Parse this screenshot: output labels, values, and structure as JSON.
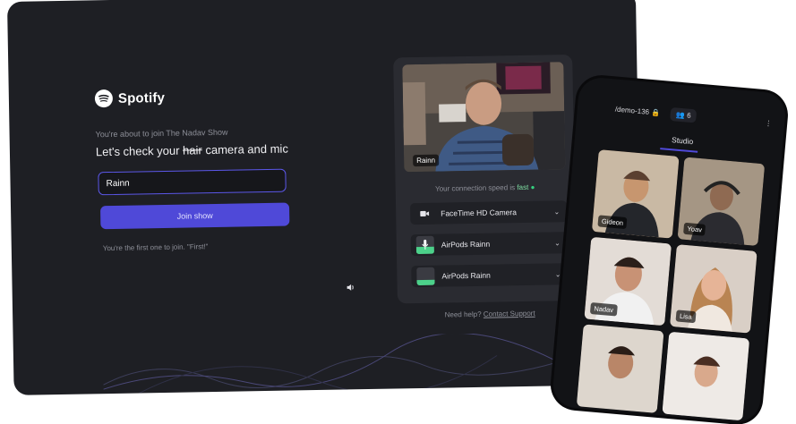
{
  "brand": {
    "name": "Spotify"
  },
  "join": {
    "about": "You're about to join The Nadav Show",
    "headline_prefix": "Let's check your",
    "headline_strike": "hair",
    "headline_suffix": "camera and mic",
    "name_value": "Rainn",
    "join_button": "Join show",
    "first_note": "You're the first one to join. \"First!\""
  },
  "preview": {
    "video_label": "Rainn",
    "speed_prefix": "Your connection speed is",
    "speed_value": "fast",
    "devices": [
      {
        "label": "FaceTime HD Camera",
        "icon": "video-camera-icon"
      },
      {
        "label": "AirPods Rainn",
        "icon": "microphone-icon"
      },
      {
        "label": "AirPods Rainn",
        "icon": "speaker-output-icon"
      }
    ],
    "help_prefix": "Need help?",
    "help_link": "Contact Support"
  },
  "phone": {
    "room": "/demo-136",
    "participants": "6",
    "tab": "Studio",
    "tiles": [
      "Gideon",
      "Yoav",
      "Nadav",
      "Lisa",
      "",
      ""
    ]
  },
  "colors": {
    "accent": "#4f49d8",
    "bg": "#1e1f24",
    "success": "#35d07f"
  }
}
